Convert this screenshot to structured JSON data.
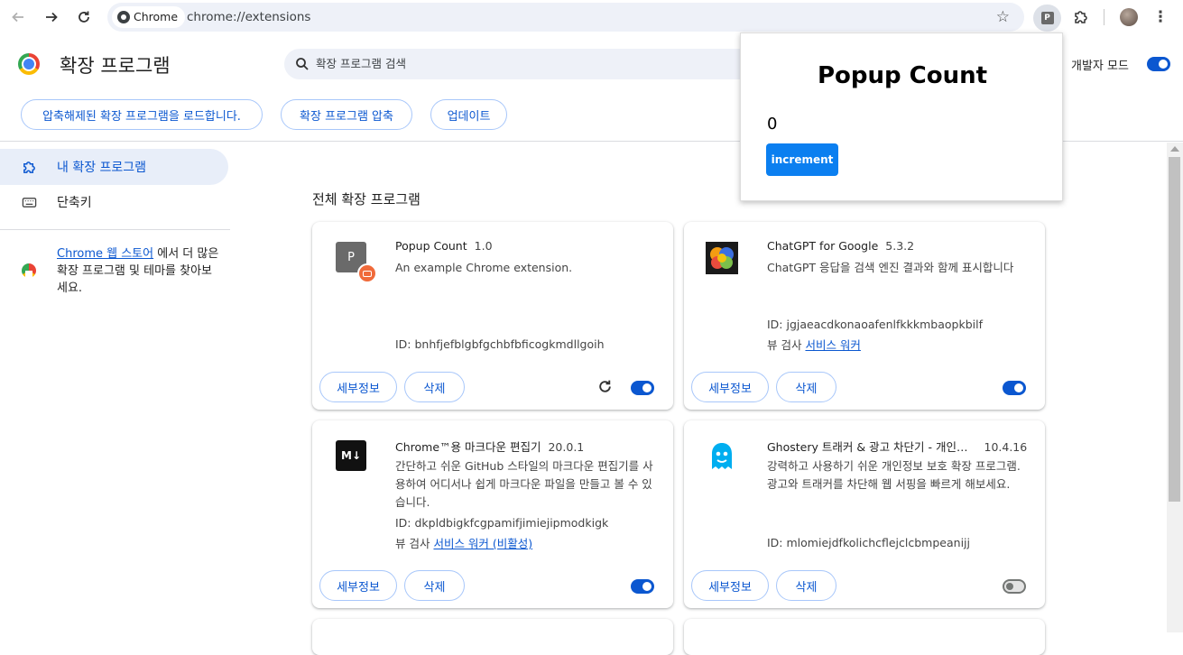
{
  "browser": {
    "chip_label": "Chrome",
    "url": "chrome://extensions",
    "active_extension_badge": "P"
  },
  "page": {
    "title": "확장 프로그램",
    "search_placeholder": "확장 프로그램 검색",
    "dev_mode_label": "개발자 모드",
    "dev_mode_on": true,
    "buttons": {
      "load_unpacked": "압축해제된 확장 프로그램을 로드합니다.",
      "pack": "확장 프로그램 압축",
      "update": "업데이트"
    }
  },
  "sidebar": {
    "items": [
      {
        "label": "내 확장 프로그램",
        "active": true
      },
      {
        "label": "단축키",
        "active": false
      }
    ],
    "store_link": "Chrome 웹 스토어",
    "store_text_rest": " 에서 더 많은 확장 프로그램 및 테마를 찾아보세요."
  },
  "section_title": "전체 확장 프로그램",
  "common": {
    "details_label": "세부정보",
    "remove_label": "삭제"
  },
  "extensions": [
    {
      "name": "Popup Count",
      "version": "1.0",
      "description": "An example Chrome extension.",
      "id": "ID: bnhfjefblgbfgchbfbficogkmdllgoih",
      "views_prefix": "",
      "views_link": "",
      "enabled": true,
      "icon_letter": "P"
    },
    {
      "name": "ChatGPT for Google",
      "version": "5.3.2",
      "description": "ChatGPT 응답을 검색 엔진 결과와 함께 표시합니다",
      "id": "ID: jgjaeacdkonaoafenlfkkkmbaopkbilf",
      "views_prefix": "뷰 검사 ",
      "views_link": "서비스 워커",
      "enabled": true
    },
    {
      "name": "Chrome™용 마크다운 편집기",
      "version": "20.0.1",
      "description": "간단하고 쉬운 GitHub 스타일의 마크다운 편집기를 사용하여 어디서나 쉽게 마크다운 파일을 만들고 볼 수 있습니다.",
      "id": "ID: dkpldbigkfcgpamifjimiejipmodkigk",
      "views_prefix": "뷰 검사 ",
      "views_link": "서비스 워커 (비활성)",
      "enabled": true,
      "icon_text": "M↓"
    },
    {
      "name": "Ghostery 트래커 & 광고 차단기 - 개인…",
      "version": "10.4.16",
      "description": "강력하고 사용하기 쉬운 개인정보 보호 확장 프로그램. 광고와 트래커를 차단해 웹 서핑을 빠르게 해보세요.",
      "id": "ID: mlomiejdfkolichcflejclcbmpeanijj",
      "views_prefix": "",
      "views_link": "",
      "enabled": false
    }
  ],
  "popup": {
    "title": "Popup Count",
    "count": "0",
    "button_label": "increment"
  },
  "colors": {
    "accent": "#0b57d0",
    "popup_button": "#0b7ff0",
    "sidebar_active_bg": "#e8eef9"
  }
}
